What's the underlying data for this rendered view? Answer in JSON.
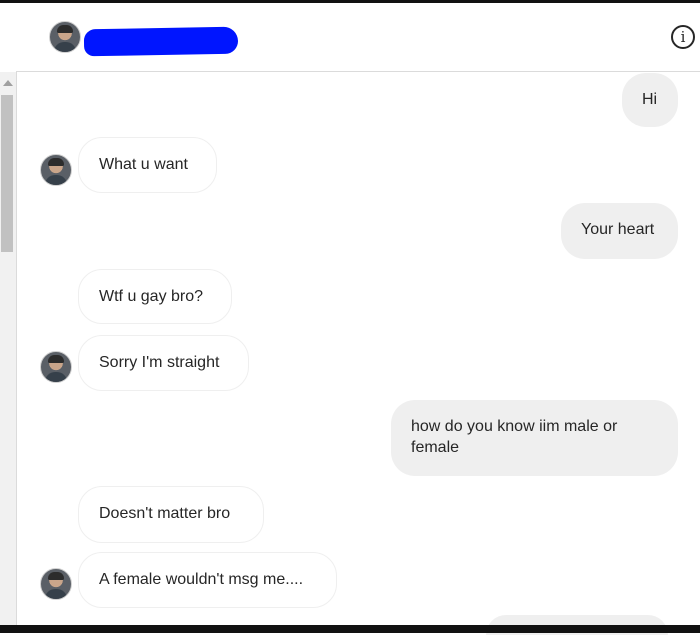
{
  "header": {
    "info_icon": "info-icon",
    "info_glyph": "i",
    "redaction_color": "#0015ff"
  },
  "messages": [
    {
      "side": "outgoing",
      "text": "Hi"
    },
    {
      "side": "incoming",
      "text": "What u want"
    },
    {
      "side": "outgoing",
      "text": "Your heart"
    },
    {
      "side": "incoming",
      "text": "Wtf u gay bro?"
    },
    {
      "side": "incoming",
      "text": "Sorry I'm straight"
    },
    {
      "side": "outgoing",
      "text": "how do you know iim male or female"
    },
    {
      "side": "incoming",
      "text": "Doesn't matter bro"
    },
    {
      "side": "incoming",
      "text": "A female wouldn't msg me...."
    }
  ],
  "colors": {
    "outgoing_bubble": "#efefef",
    "incoming_bubble": "#ffffff",
    "text": "#262626",
    "divider": "#dbdbdb"
  }
}
